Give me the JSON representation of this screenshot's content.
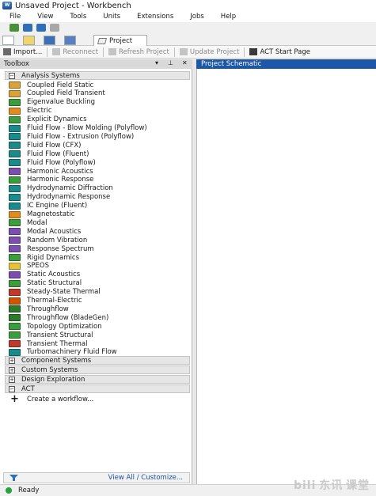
{
  "window": {
    "title": "Unsaved Project - Workbench"
  },
  "menu": [
    "File",
    "View",
    "Tools",
    "Units",
    "Extensions",
    "Jobs",
    "Help"
  ],
  "tabs": {
    "project": "Project"
  },
  "toolbar": {
    "import": "Import...",
    "reconnect": "Reconnect",
    "refresh": "Refresh Project",
    "update": "Update Project",
    "act_start": "ACT Start Page"
  },
  "toolbox": {
    "title": "Toolbox",
    "controls": [
      "▾",
      "⊥",
      "✕"
    ],
    "analysis_header": "Analysis Systems",
    "items": [
      {
        "label": "Coupled Field Static",
        "color": "#d9a23a"
      },
      {
        "label": "Coupled Field Transient",
        "color": "#d9a23a"
      },
      {
        "label": "Eigenvalue Buckling",
        "color": "#3d9c3d"
      },
      {
        "label": "Electric",
        "color": "#e08b1f"
      },
      {
        "label": "Explicit Dynamics",
        "color": "#3d9c3d"
      },
      {
        "label": "Fluid Flow - Blow Molding (Polyflow)",
        "color": "#1b8a8a"
      },
      {
        "label": "Fluid Flow - Extrusion (Polyflow)",
        "color": "#1b8a8a"
      },
      {
        "label": "Fluid Flow (CFX)",
        "color": "#1b8a8a"
      },
      {
        "label": "Fluid Flow (Fluent)",
        "color": "#1b8a8a"
      },
      {
        "label": "Fluid Flow (Polyflow)",
        "color": "#1b8a8a"
      },
      {
        "label": "Harmonic Acoustics",
        "color": "#7a4fb0"
      },
      {
        "label": "Harmonic Response",
        "color": "#3d9c3d"
      },
      {
        "label": "Hydrodynamic Diffraction",
        "color": "#1b8a8a"
      },
      {
        "label": "Hydrodynamic Response",
        "color": "#1b8a8a"
      },
      {
        "label": "IC Engine (Fluent)",
        "color": "#1b8a8a"
      },
      {
        "label": "Magnetostatic",
        "color": "#e08b1f"
      },
      {
        "label": "Modal",
        "color": "#3d9c3d"
      },
      {
        "label": "Modal Acoustics",
        "color": "#7a4fb0"
      },
      {
        "label": "Random Vibration",
        "color": "#7a4fb0"
      },
      {
        "label": "Response Spectrum",
        "color": "#7a4fb0"
      },
      {
        "label": "Rigid Dynamics",
        "color": "#3d9c3d"
      },
      {
        "label": "SPEOS",
        "color": "#e6c23a"
      },
      {
        "label": "Static Acoustics",
        "color": "#7a4fb0"
      },
      {
        "label": "Static Structural",
        "color": "#3d9c3d"
      },
      {
        "label": "Steady-State Thermal",
        "color": "#c0392b"
      },
      {
        "label": "Thermal-Electric",
        "color": "#d35400"
      },
      {
        "label": "Throughflow",
        "color": "#2c7a2c"
      },
      {
        "label": "Throughflow (BladeGen)",
        "color": "#2c7a2c"
      },
      {
        "label": "Topology Optimization",
        "color": "#3d9c3d"
      },
      {
        "label": "Transient Structural",
        "color": "#3d9c3d"
      },
      {
        "label": "Transient Thermal",
        "color": "#c0392b"
      },
      {
        "label": "Turbomachinery Fluid Flow",
        "color": "#1b8a8a"
      }
    ],
    "groups": {
      "component": "Component Systems",
      "custom": "Custom Systems",
      "design": "Design Exploration",
      "act": "ACT"
    },
    "act_item": "Create a workflow...",
    "footer_link": "View All / Customize..."
  },
  "schematic": {
    "title": "Project Schematic"
  },
  "status": {
    "text": "Ready"
  },
  "watermark": "bili 东讯 课堂"
}
